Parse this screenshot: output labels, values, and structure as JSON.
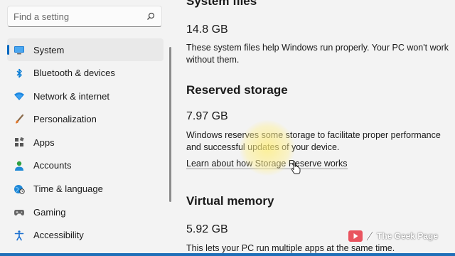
{
  "search": {
    "placeholder": "Find a setting",
    "icon": "search-icon"
  },
  "sidebar": {
    "items": [
      {
        "label": "System",
        "icon": "monitor-icon",
        "active": true
      },
      {
        "label": "Bluetooth & devices",
        "icon": "bluetooth-icon"
      },
      {
        "label": "Network & internet",
        "icon": "wifi-icon"
      },
      {
        "label": "Personalization",
        "icon": "brush-icon"
      },
      {
        "label": "Apps",
        "icon": "apps-icon"
      },
      {
        "label": "Accounts",
        "icon": "person-icon"
      },
      {
        "label": "Time & language",
        "icon": "globe-clock-icon"
      },
      {
        "label": "Gaming",
        "icon": "gamepad-icon"
      },
      {
        "label": "Accessibility",
        "icon": "accessibility-icon"
      }
    ]
  },
  "main": {
    "system_files": {
      "title": "System files",
      "size": "14.8 GB",
      "description": "These system files help Windows run properly. Your PC won't work without them."
    },
    "reserved_storage": {
      "title": "Reserved storage",
      "size": "7.97 GB",
      "description": "Windows reserves some storage to facilitate proper performance and successful updates of your device.",
      "link": "Learn about how Storage Reserve works"
    },
    "virtual_memory": {
      "title": "Virtual memory",
      "size": "5.92 GB",
      "description": "This lets your PC run multiple apps at the same time."
    }
  },
  "watermark": {
    "text": "The Geek Page"
  },
  "colors": {
    "accent": "#0067c0",
    "background": "#f3f3f3"
  }
}
